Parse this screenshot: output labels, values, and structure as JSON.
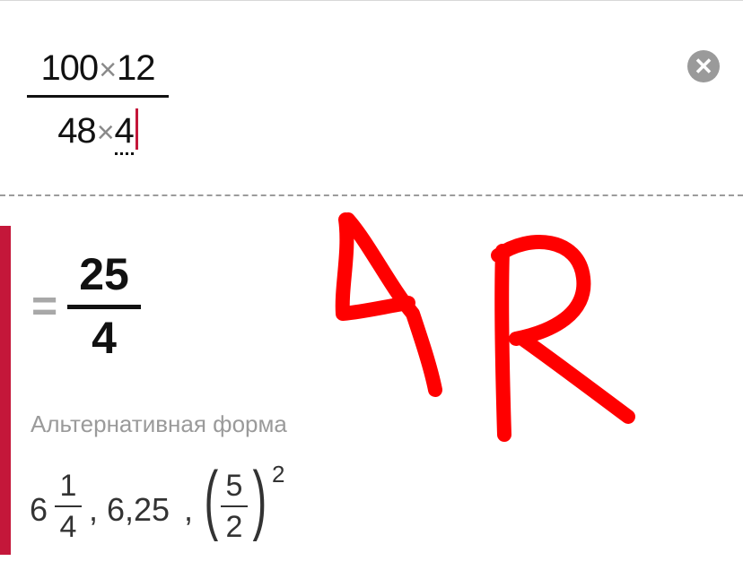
{
  "input": {
    "numerator_a": "100",
    "numerator_b": "12",
    "denominator_a": "48",
    "denominator_b": "4",
    "times_symbol": "×"
  },
  "clear_button": {
    "icon": "close-circle-icon"
  },
  "result": {
    "equals": "=",
    "numerator": "25",
    "denominator": "4"
  },
  "alternative": {
    "label": "Альтернативная форма",
    "mixed_whole": "6",
    "mixed_num": "1",
    "mixed_den": "4",
    "sep1": ",",
    "decimal": "6,25",
    "sep2": ",",
    "power_num": "5",
    "power_den": "2",
    "paren_open": "(",
    "paren_close": ")",
    "exponent": "2"
  },
  "colors": {
    "accent": "#c4173a",
    "annotation": "#ff0000"
  },
  "annotation": {
    "text": "AR"
  }
}
